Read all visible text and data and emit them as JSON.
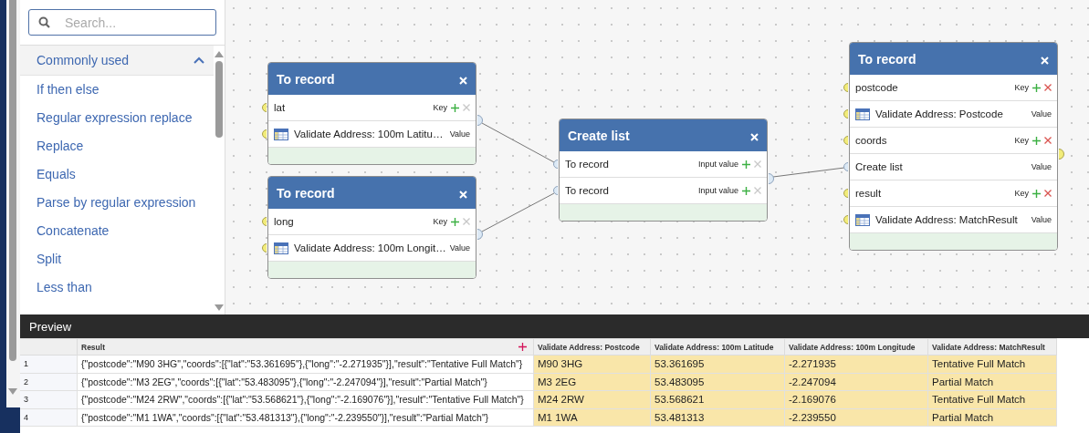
{
  "search": {
    "placeholder": "Search..."
  },
  "palette": {
    "group": {
      "label": "Commonly used",
      "expanded": true
    },
    "items": [
      "If then else",
      "Regular expression replace",
      "Replace",
      "Equals",
      "Parse by regular expression",
      "Concatenate",
      "Split",
      "Less than"
    ]
  },
  "nodes": [
    {
      "title": "To record",
      "output_connected": true,
      "rows": [
        {
          "kind": "key",
          "label": "lat",
          "tag": "Key",
          "table_icon": false,
          "connected": false,
          "removable": false
        },
        {
          "kind": "value",
          "label": "Validate Address: 100m Latitu…",
          "tag": "Value",
          "table_icon": true,
          "connected": false
        }
      ]
    },
    {
      "title": "To record",
      "output_connected": true,
      "rows": [
        {
          "kind": "key",
          "label": "long",
          "tag": "Key",
          "table_icon": false,
          "connected": false,
          "removable": false
        },
        {
          "kind": "value",
          "label": "Validate Address: 100m Longit…",
          "tag": "Value",
          "table_icon": true,
          "connected": false
        }
      ]
    },
    {
      "title": "Create list",
      "output_connected": true,
      "rows": [
        {
          "kind": "key",
          "label": "To record",
          "tag": "Input value",
          "table_icon": false,
          "connected": true,
          "removable": false
        },
        {
          "kind": "key",
          "label": "To record",
          "tag": "Input value",
          "table_icon": false,
          "connected": true,
          "removable": false
        }
      ]
    },
    {
      "title": "To record",
      "output_connected": false,
      "rows": [
        {
          "kind": "key",
          "label": "postcode",
          "tag": "Key",
          "table_icon": false,
          "connected": false,
          "removable": true
        },
        {
          "kind": "value",
          "label": "Validate Address: Postcode",
          "tag": "Value",
          "table_icon": true,
          "connected": false
        },
        {
          "kind": "key",
          "label": "coords",
          "tag": "Key",
          "table_icon": false,
          "connected": false,
          "removable": true
        },
        {
          "kind": "value",
          "label": "Create list",
          "tag": "Value",
          "table_icon": false,
          "connected": true
        },
        {
          "kind": "key",
          "label": "result",
          "tag": "Key",
          "table_icon": false,
          "connected": false,
          "removable": true
        },
        {
          "kind": "value",
          "label": "Validate Address: MatchResult",
          "tag": "Value",
          "table_icon": true,
          "connected": false
        }
      ]
    }
  ],
  "preview": {
    "title": "Preview",
    "columns": [
      {
        "label": "Result",
        "highlighted": false
      },
      {
        "label": "Validate Address: Postcode",
        "highlighted": true
      },
      {
        "label": "Validate Address: 100m Latitude",
        "highlighted": true
      },
      {
        "label": "Validate Address: 100m Longitude",
        "highlighted": true
      },
      {
        "label": "Validate Address: MatchResult",
        "highlighted": true
      }
    ],
    "rows": [
      {
        "number": "1",
        "cells": [
          "{\"postcode\":\"M90 3HG\",\"coords\":[{\"lat\":\"53.361695\"},{\"long\":\"-2.271935\"}],\"result\":\"Tentative Full Match\"}",
          "M90 3HG",
          "53.361695",
          "-2.271935",
          "Tentative Full Match"
        ]
      },
      {
        "number": "2",
        "cells": [
          "{\"postcode\":\"M3 2EG\",\"coords\":[{\"lat\":\"53.483095\"},{\"long\":\"-2.247094\"}],\"result\":\"Partial Match\"}",
          "M3 2EG",
          "53.483095",
          "-2.247094",
          "Partial Match"
        ]
      },
      {
        "number": "3",
        "cells": [
          "{\"postcode\":\"M24 2RW\",\"coords\":[{\"lat\":\"53.568621\"},{\"long\":\"-2.169076\"}],\"result\":\"Tentative Full Match\"}",
          "M24 2RW",
          "53.568621",
          "-2.169076",
          "Tentative Full Match"
        ]
      },
      {
        "number": "4",
        "cells": [
          "{\"postcode\":\"M1 1WA\",\"coords\":[{\"lat\":\"53.481313\"},{\"long\":\"-2.239550\"}],\"result\":\"Partial Match\"}",
          "M1 1WA",
          "53.481313",
          "-2.239550",
          "Partial Match"
        ]
      }
    ]
  }
}
